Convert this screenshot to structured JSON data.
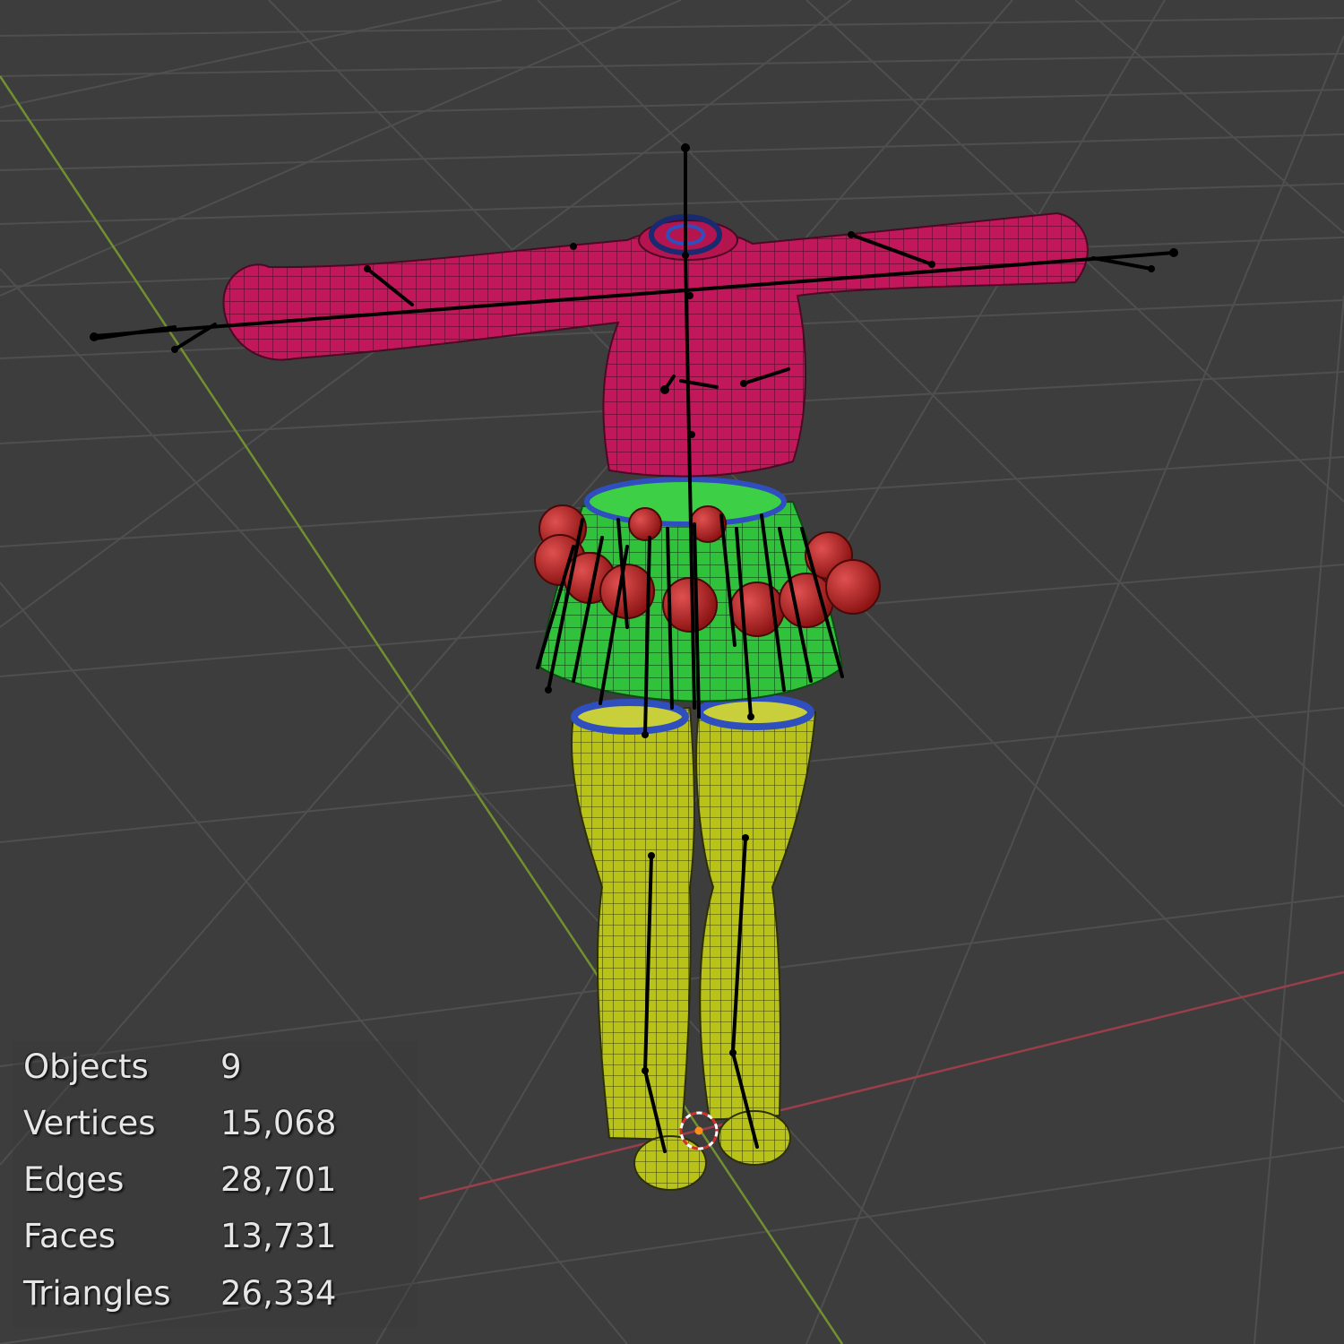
{
  "viewport": {
    "background": "#3d3d3d",
    "grid_color": "#4f4f4f",
    "x_axis_color": "#9a3e4a",
    "y_axis_color": "#71902f",
    "mesh_colors": {
      "shirt": "#c2185b",
      "skirt": "#2fc23a",
      "tights": "#b8c217",
      "ornaments": "#c62828",
      "trim": "#2f4fbf",
      "armature": "#000000"
    },
    "origin_icon": "3d-cursor-icon"
  },
  "stats": [
    {
      "label": "Objects",
      "value": "9"
    },
    {
      "label": "Vertices",
      "value": "15,068"
    },
    {
      "label": "Edges",
      "value": "28,701"
    },
    {
      "label": "Faces",
      "value": "13,731"
    },
    {
      "label": "Triangles",
      "value": "26,334"
    }
  ]
}
